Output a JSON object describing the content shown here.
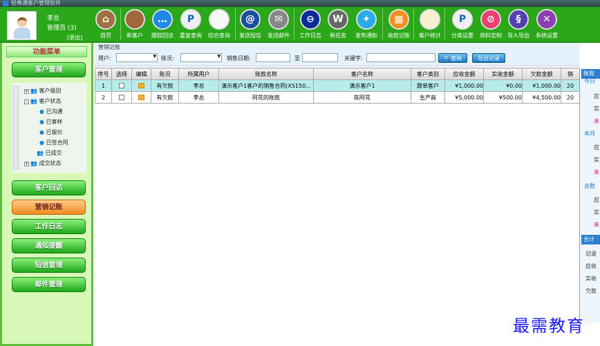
{
  "window": {
    "title": "轻尊通客户管理软件"
  },
  "user": {
    "name": "李总",
    "role": "管理员 (3)",
    "logout": "[退出]"
  },
  "toolbar": [
    {
      "label": "首页",
      "icon": "home-icon",
      "color": "#a07040"
    },
    {
      "label": "新客户",
      "icon": "new-customer-icon",
      "color": "#a0683a"
    },
    {
      "label": "跟踪回访",
      "icon": "chat-icon",
      "color": "#1e88e5"
    },
    {
      "label": "重复查询",
      "icon": "p-icon",
      "color": "#f0f0f0"
    },
    {
      "label": "综合查询",
      "icon": "list-icon",
      "color": "#f8f8f8"
    },
    {
      "label": "发送短信",
      "icon": "sms-icon",
      "color": "#1a4fa0"
    },
    {
      "label": "发送邮件",
      "icon": "mail-icon",
      "color": "#888888"
    },
    {
      "label": "工作日志",
      "icon": "log-icon",
      "color": "#0a2a9a"
    },
    {
      "label": "新任务",
      "icon": "task-icon",
      "color": "#666666"
    },
    {
      "label": "发布通知",
      "icon": "twitter-icon",
      "color": "#2aaae8"
    },
    {
      "label": "收款记账",
      "icon": "accounting-icon",
      "color": "#f09020"
    },
    {
      "label": "客户统计",
      "icon": "notepad-icon",
      "color": "#f8f0d0"
    },
    {
      "label": "分类设置",
      "icon": "p-icon",
      "color": "#f0f0f0"
    },
    {
      "label": "资料定制",
      "icon": "custom-icon",
      "color": "#e84070"
    },
    {
      "label": "导入导出",
      "icon": "python-icon",
      "color": "#5040b0"
    },
    {
      "label": "系统设置",
      "icon": "tools-icon",
      "color": "#8a40b0"
    }
  ],
  "sidebar": {
    "title": "功能菜单",
    "top_button": "客户管理",
    "tree": [
      "客户级别",
      "客户状态",
      "已沟通",
      "已寄样",
      "已报价",
      "已签合同",
      "已成交",
      "成交状态"
    ],
    "buttons": [
      "客户回访",
      "营销记账",
      "工作日志",
      "通知提醒",
      "短信管理",
      "邮件管理"
    ],
    "active": "营销记账"
  },
  "filters": {
    "group": "营销记账",
    "user_label": "用户:",
    "user_value": "",
    "status_label": "账况:",
    "status_value": "",
    "date_label": "销售日期:",
    "date_from": "",
    "to_label": "至",
    "date_to": "",
    "keyword_label": "关键字:",
    "keyword_value": "",
    "search": "查询",
    "export": "导出记录"
  },
  "table": {
    "columns": [
      "序号",
      "选择",
      "编辑",
      "账况",
      "所属用户",
      "账款名称",
      "客户名称",
      "客户类别",
      "应收金额",
      "实收金额",
      "欠款金额",
      "销"
    ],
    "rows": [
      [
        "1",
        "",
        "",
        "有欠款",
        "李总",
        "演示客户1客户的销售合同(XS150...",
        "演示客户1",
        "跟单客户",
        "¥1,000.00",
        "¥0.00",
        "¥1,000.00",
        "20"
      ],
      [
        "2",
        "",
        "",
        "有欠款",
        "李总",
        "阿花的账款",
        "陈阿花",
        "生产商",
        "¥5,000.00",
        "¥500.00",
        "¥4,500.00",
        "20"
      ]
    ]
  },
  "right_panel": {
    "header": "账款",
    "today": "今日",
    "month": "本月",
    "total": "总数",
    "due": "应",
    "paid": "实",
    "unpaid": "未",
    "sum_header": "合计",
    "records": "记录",
    "receivable": "应收",
    "received": "实收",
    "owed": "欠款"
  },
  "watermark": "最需教育"
}
